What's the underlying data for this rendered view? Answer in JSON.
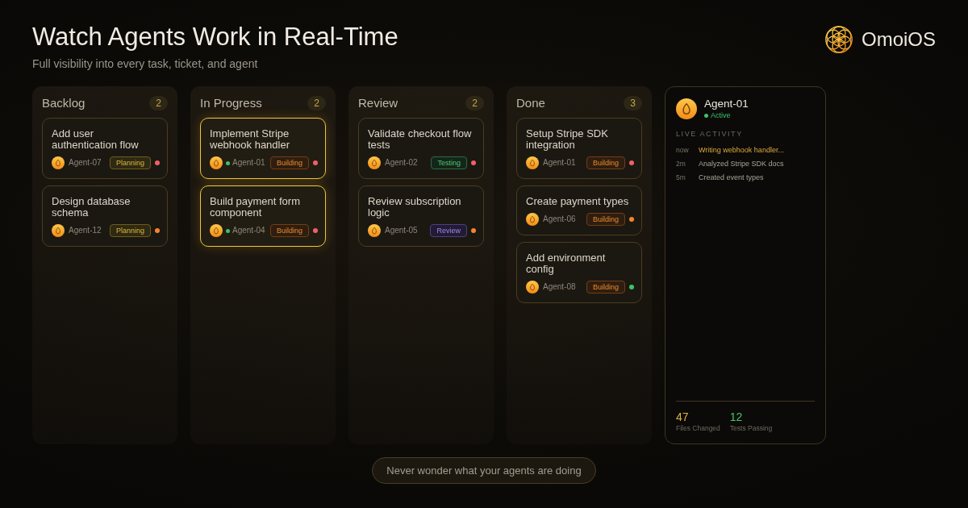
{
  "header": {
    "title": "Watch Agents Work in Real-Time",
    "subtitle": "Full visibility into every task, ticket, and agent"
  },
  "brand": {
    "name": "OmoiOS"
  },
  "columns": [
    {
      "title": "Backlog",
      "count": "2",
      "cards": [
        {
          "title": "Add user authentication flow",
          "agent": "Agent-07",
          "agent_online": false,
          "tag": {
            "label": "Planning",
            "kind": "planning"
          },
          "color": "#f25f68",
          "highlighted": false
        },
        {
          "title": "Design database schema",
          "agent": "Agent-12",
          "agent_online": false,
          "tag": {
            "label": "Planning",
            "kind": "planning"
          },
          "color": "#f5852a",
          "highlighted": false
        }
      ]
    },
    {
      "title": "In Progress",
      "count": "2",
      "cards": [
        {
          "title": "Implement Stripe webhook handler",
          "agent": "Agent-01",
          "agent_online": true,
          "tag": {
            "label": "Building",
            "kind": "building"
          },
          "color": "#f25f68",
          "highlighted": true
        },
        {
          "title": "Build payment form component",
          "agent": "Agent-04",
          "agent_online": true,
          "tag": {
            "label": "Building",
            "kind": "building"
          },
          "color": "#f25f68",
          "highlighted": true
        }
      ]
    },
    {
      "title": "Review",
      "count": "2",
      "cards": [
        {
          "title": "Validate checkout flow tests",
          "agent": "Agent-02",
          "agent_online": false,
          "tag": {
            "label": "Testing",
            "kind": "testing"
          },
          "color": "#f25f68",
          "highlighted": false
        },
        {
          "title": "Review subscription logic",
          "agent": "Agent-05",
          "agent_online": false,
          "tag": {
            "label": "Review",
            "kind": "review"
          },
          "color": "#f5852a",
          "highlighted": false
        }
      ]
    },
    {
      "title": "Done",
      "count": "3",
      "cards": [
        {
          "title": "Setup Stripe SDK integration",
          "agent": "Agent-01",
          "agent_online": false,
          "tag": {
            "label": "Building",
            "kind": "building"
          },
          "color": "#f25f68",
          "highlighted": false
        },
        {
          "title": "Create payment types",
          "agent": "Agent-06",
          "agent_online": false,
          "tag": {
            "label": "Building",
            "kind": "building"
          },
          "color": "#f5852a",
          "highlighted": false
        },
        {
          "title": "Add environment config",
          "agent": "Agent-08",
          "agent_online": false,
          "tag": {
            "label": "Building",
            "kind": "building"
          },
          "color": "#3ec267",
          "highlighted": false
        }
      ]
    }
  ],
  "agent_panel": {
    "name": "Agent-01",
    "status": "Active",
    "section_title": "LIVE ACTIVITY",
    "activity": [
      {
        "time": "now",
        "text": "Writing webhook handler...",
        "current": true
      },
      {
        "time": "2m",
        "text": "Analyzed Stripe SDK docs",
        "current": false
      },
      {
        "time": "5m",
        "text": "Created event types",
        "current": false
      }
    ],
    "stats": [
      {
        "value": "47",
        "label": "Files Changed",
        "color": "#e3b23c"
      },
      {
        "value": "12",
        "label": "Tests Passing",
        "color": "#45c46a"
      }
    ]
  },
  "tagline": "Never wonder what your agents are doing"
}
